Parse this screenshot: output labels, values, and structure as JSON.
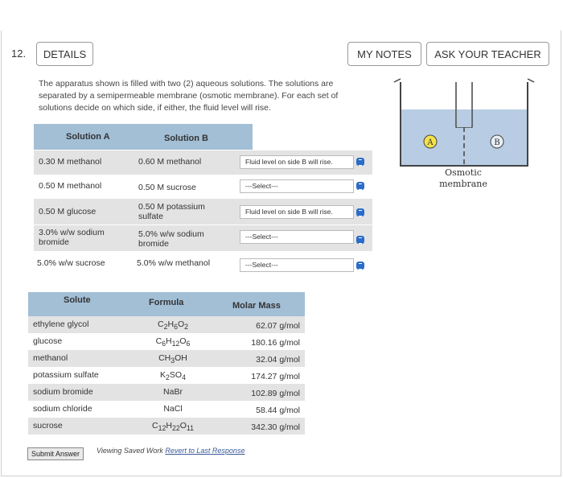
{
  "question": {
    "number": "12.",
    "details_label": "DETAILS",
    "my_notes_label": "MY NOTES",
    "ask_teacher_label": "ASK YOUR TEACHER",
    "prompt": "The apparatus shown is filled with two (2) aqueous solutions. The solutions are separated by a semipermeable membrane (osmotic membrane). For each set of solutions decide on which side, if either, the fluid level will rise."
  },
  "solutions_table": {
    "header_a": "Solution A",
    "header_b": "Solution B",
    "rows": [
      {
        "a": "0.30 M methanol",
        "b": "0.60 M methanol",
        "select": "Fluid level on side B will rise."
      },
      {
        "a": "0.50 M methanol",
        "b": "0.50 M sucrose",
        "select": "---Select---"
      },
      {
        "a": "0.50 M glucose",
        "b": "0.50 M potassium sulfate",
        "select": "Fluid level on side B will rise."
      },
      {
        "a": "3.0% w/w sodium bromide",
        "b": "5.0% w/w sodium bromide",
        "select": "---Select---"
      },
      {
        "a": "5.0% w/w sucrose",
        "b": "5.0% w/w methanol",
        "select": "---Select---"
      }
    ]
  },
  "molar_table": {
    "header_solute": "Solute",
    "header_formula": "Formula",
    "header_mass": "Molar Mass",
    "rows": [
      {
        "solute": "ethylene glycol",
        "formula": "C2H6O2",
        "mass": "62.07 g/mol"
      },
      {
        "solute": "glucose",
        "formula": "C6H12O6",
        "mass": "180.16 g/mol"
      },
      {
        "solute": "methanol",
        "formula": "CH3OH",
        "mass": "32.04 g/mol"
      },
      {
        "solute": "potassium sulfate",
        "formula": "K2SO4",
        "mass": "174.27 g/mol"
      },
      {
        "solute": "sodium bromide",
        "formula": "NaBr",
        "mass": "102.89 g/mol"
      },
      {
        "solute": "sodium chloride",
        "formula": "NaCl",
        "mass": "58.44 g/mol"
      },
      {
        "solute": "sucrose",
        "formula": "C12H22O11",
        "mass": "342.30 g/mol"
      }
    ]
  },
  "figure": {
    "label_a": "A",
    "label_b": "B",
    "membrane_label": "Osmotic membrane"
  },
  "footer": {
    "submit_label": "Submit Answer",
    "viewing_text": "Viewing Saved Work",
    "revert_link": "Revert to Last Response"
  },
  "colors": {
    "header_bg": "#a3bfd6",
    "row_shade": "#e3e3e3",
    "spinner": "#2a6cc8",
    "liquid": "#b8cde3"
  }
}
